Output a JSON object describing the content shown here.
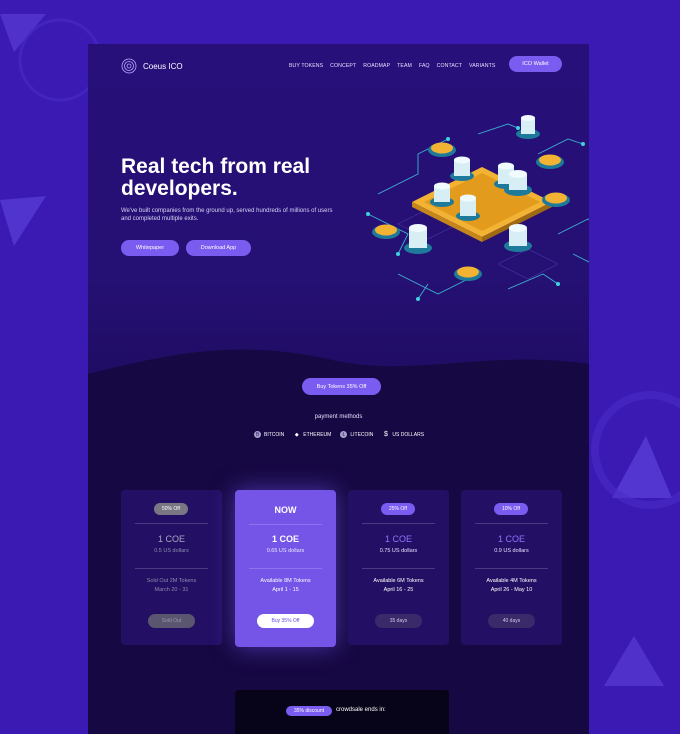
{
  "brand": {
    "name": "Coeus ICO"
  },
  "nav": {
    "items": [
      "BUY TOKENS",
      "CONCEPT",
      "ROADMAP",
      "TEAM",
      "FAQ",
      "CONTACT",
      "VARIANTS"
    ],
    "wallet_label": "ICO Wallet"
  },
  "hero": {
    "title": "Real tech from real developers.",
    "subtitle": "We've built companies from the ground up, served hundreds of millions of users and completed multiple exits.",
    "whitepaper_label": "Whitepaper",
    "download_label": "Download App"
  },
  "cta": {
    "label": "Buy Tokens 35% Off"
  },
  "payment": {
    "title": "payment methods",
    "methods": [
      {
        "label": "BITCOIN",
        "icon": "bitcoin-icon"
      },
      {
        "label": "ETHEREUM",
        "icon": "ethereum-icon"
      },
      {
        "label": "LITECOIN",
        "icon": "litecoin-icon"
      },
      {
        "label": "US DOLLARS",
        "icon": "dollar-icon"
      }
    ]
  },
  "tiers": [
    {
      "badge": "50% Off",
      "coe": "1 COE",
      "price": "0.5 US dollars",
      "note1": "Sold Out 2M Tokens",
      "note2": "March 20 - 31",
      "button": "Sold Out"
    },
    {
      "badge": "NOW",
      "coe": "1 COE",
      "price": "0.65 US dollars",
      "note1": "Available 8M Tokens",
      "note2": "April 1 - 15",
      "button": "Buy 35% Off"
    },
    {
      "badge": "25% Off",
      "coe": "1 COE",
      "price": "0.75 US dollars",
      "note1": "Available 6M Tokens",
      "note2": "April 16 - 25",
      "button": "35 days"
    },
    {
      "badge": "10% Off",
      "coe": "1 COE",
      "price": "0.9 US dollars",
      "note1": "Available 4M Tokens",
      "note2": "April 26 - May 10",
      "button": "40 days"
    }
  ],
  "countdown": {
    "badge": "35% discount",
    "text": "crowdsale ends in:"
  },
  "colors": {
    "accent": "#7b5cf0",
    "background": "#3a1ab3",
    "page": "#1c0a52",
    "coin": "#f2b233",
    "teal": "#3fd0e0"
  }
}
